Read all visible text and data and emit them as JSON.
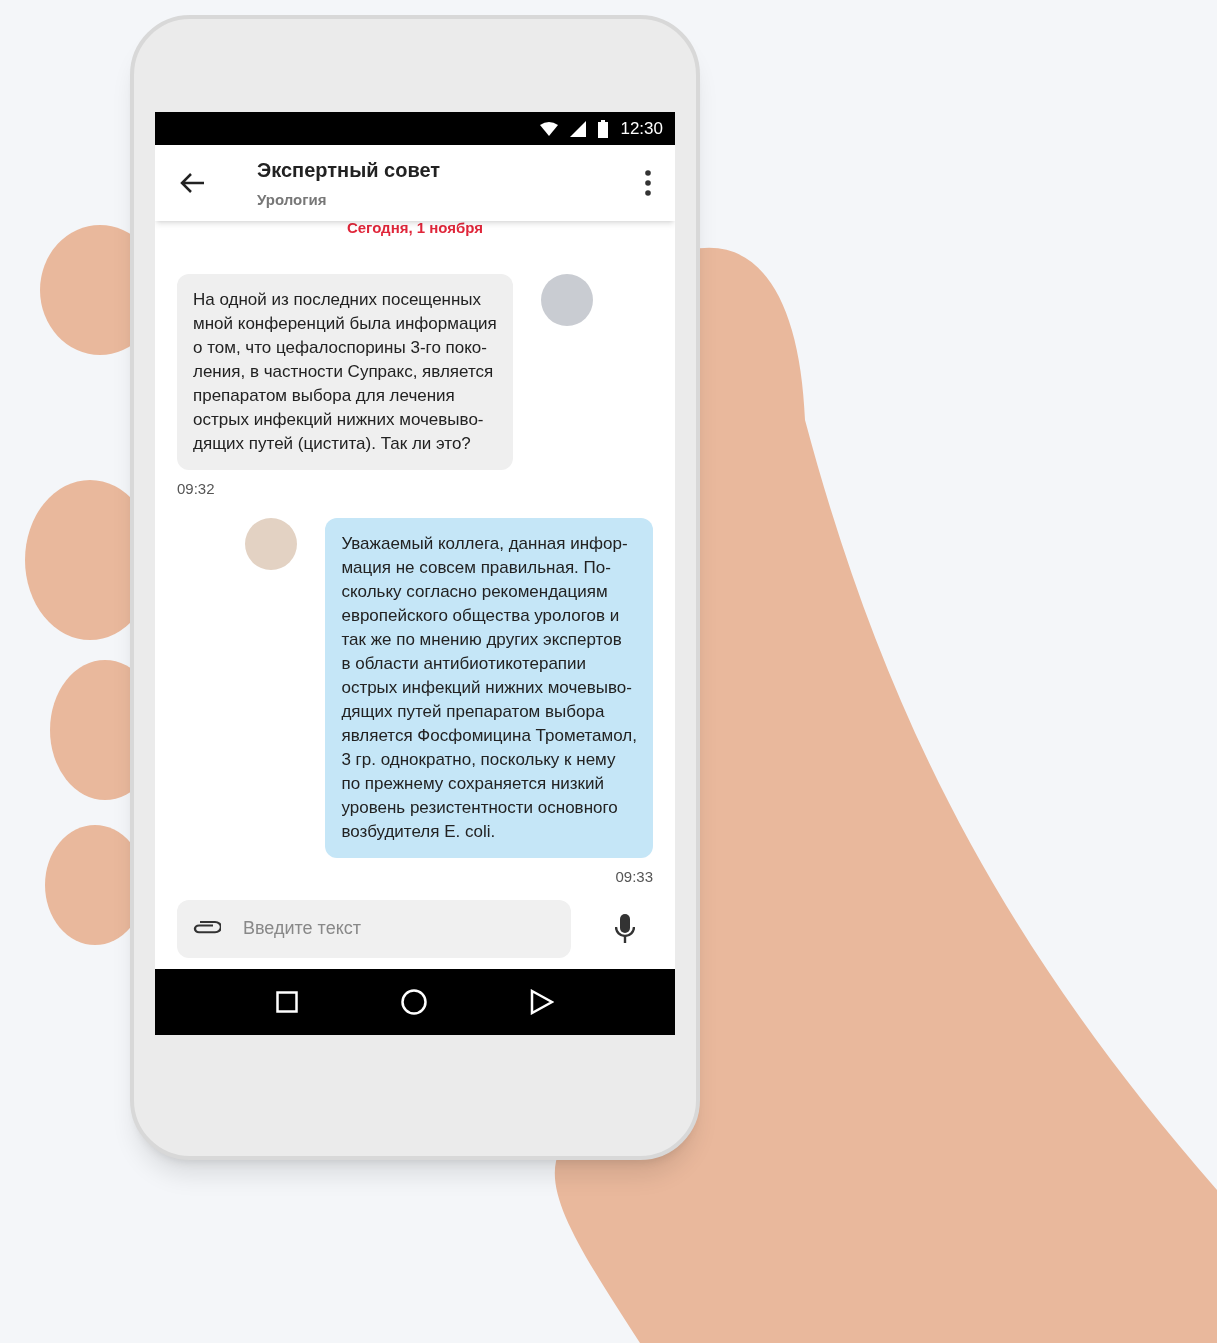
{
  "status_bar": {
    "time": "12:30"
  },
  "header": {
    "title": "Экспертный совет",
    "subtitle": "Урология"
  },
  "date_divider": "Сегодня, 1 ноября",
  "messages": [
    {
      "kind": "incoming",
      "text": "На одной из последних посещенных\nмной конференций была информация\nо том, что цефалоспорины 3-го поко-\nления, в частности Супракс, является\nпрепаратом выбора для лечения\nострых инфекций нижних мочевыво-\nдящих путей (цистита). Так ли это?",
      "time": "09:32"
    },
    {
      "kind": "outgoing",
      "text": "Уважаемый коллега, данная инфор-\nмация не совсем правильная. По-\nскольку согласно рекомендациям\nевропейского общества урологов и\nтак же по мнению других экспертов\nв области антибиотикотерапии\nострых инфекций нижних мочевыво-\nдящих путей препаратом выбора\nявляется Фосфомицина Трометамол,\n3 гр. однократно, поскольку к нему\nпо прежнему сохраняется низкий\nуровень резистентности основного\nвозбудителя E. coli.",
      "time": "09:33"
    }
  ],
  "input": {
    "placeholder": "Введите текст"
  }
}
